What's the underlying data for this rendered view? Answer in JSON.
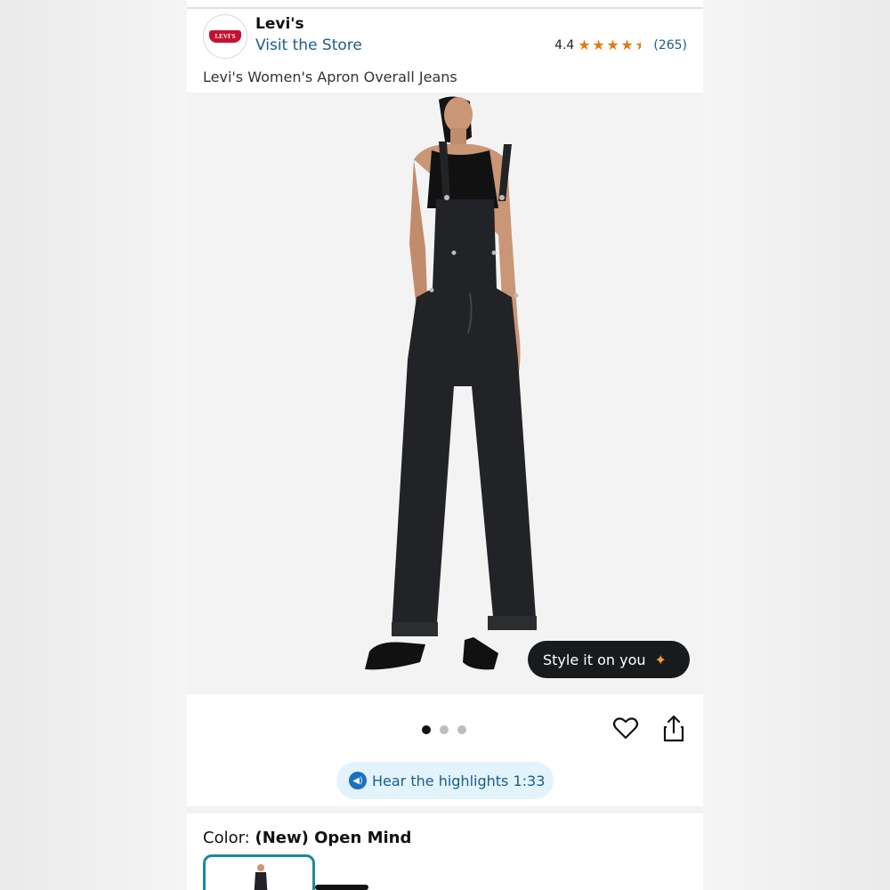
{
  "header": {
    "brand_logo_text": "LEVI'S",
    "brand_name": "Levi's",
    "store_link": "Visit the Store",
    "rating_value": "4.4",
    "rating_stars": 4.4,
    "rating_count": "(265)"
  },
  "product": {
    "title": "Levi's Women's Apron Overall Jeans",
    "style_button": "Style it on you"
  },
  "gallery": {
    "dot_count": 3,
    "active_index": 0
  },
  "highlights": {
    "label": "Hear the highlights 1:33"
  },
  "color": {
    "label": "Color: ",
    "value": "(New) Open Mind"
  },
  "icons": [
    "levis-logo-icon",
    "star-icon",
    "sparkle-icon",
    "heart-icon",
    "share-icon",
    "audio-icon"
  ],
  "colors": {
    "link": "#1a5d8c",
    "star": "#e47911",
    "accent_swatch": "#1a8a9b",
    "dark_button": "#171b1d"
  }
}
